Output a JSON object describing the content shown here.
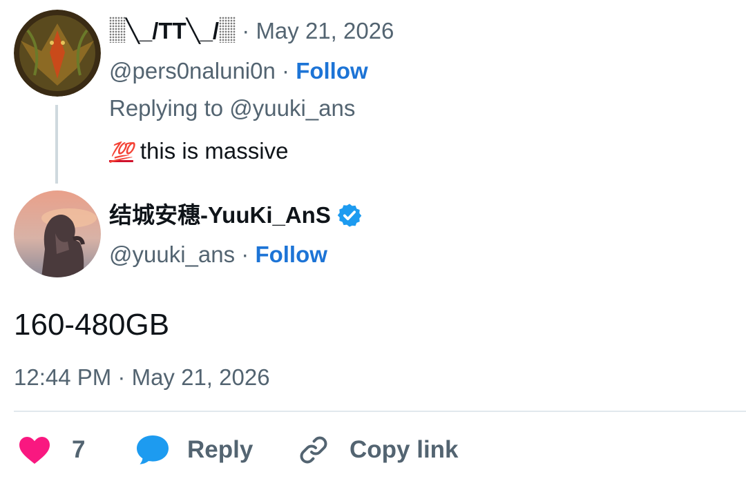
{
  "parent_tweet": {
    "display_name": "╲_/TT╲_/",
    "date_separator": "·",
    "date": "May 21, 2026",
    "handle": "@pers0naluni0n",
    "follow_separator": "·",
    "follow_label": "Follow",
    "replying_to": "Replying to @yuuki_ans",
    "emoji": "💯",
    "text": "this is massive"
  },
  "main_tweet": {
    "display_name": "结城安穗-YuuKi_AnS",
    "verified": true,
    "handle": "@yuuki_ans",
    "follow_separator": "·",
    "follow_label": "Follow",
    "text": "160-480GB",
    "timestamp": "12:44 PM · May 21, 2026"
  },
  "actions": {
    "like_count": "7",
    "reply_label": "Reply",
    "copy_link_label": "Copy link"
  },
  "colors": {
    "accent": "#1d74d6",
    "muted": "#536471",
    "like": "#f91880",
    "verified": "#1d9bf0"
  },
  "icons": [
    "heart-icon",
    "reply-bubble-icon",
    "link-icon",
    "verified-badge-icon",
    "hundred-points-emoji"
  ]
}
